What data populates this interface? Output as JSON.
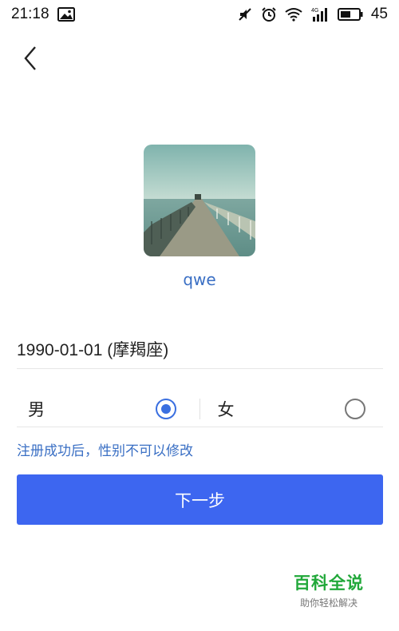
{
  "status_bar": {
    "time": "21:18",
    "battery": "45",
    "network_label": "4G",
    "icons": [
      "image-icon",
      "mute-icon",
      "alarm-icon",
      "wifi-icon",
      "signal-icon",
      "battery-icon"
    ]
  },
  "header": {
    "back_icon": "chevron-left-icon"
  },
  "profile": {
    "username": "qwe"
  },
  "form": {
    "birthday": "1990-01-01 (摩羯座)",
    "gender": {
      "male_label": "男",
      "female_label": "女",
      "selected": "male"
    },
    "hint": "注册成功后，性别不可以修改",
    "next_label": "下一步"
  },
  "watermark": {
    "title": "百科全说",
    "subtitle": "助你轻松解决"
  },
  "colors": {
    "accent": "#3d66f0",
    "link": "#3a6fc4",
    "watermark_green": "#21a83a"
  }
}
